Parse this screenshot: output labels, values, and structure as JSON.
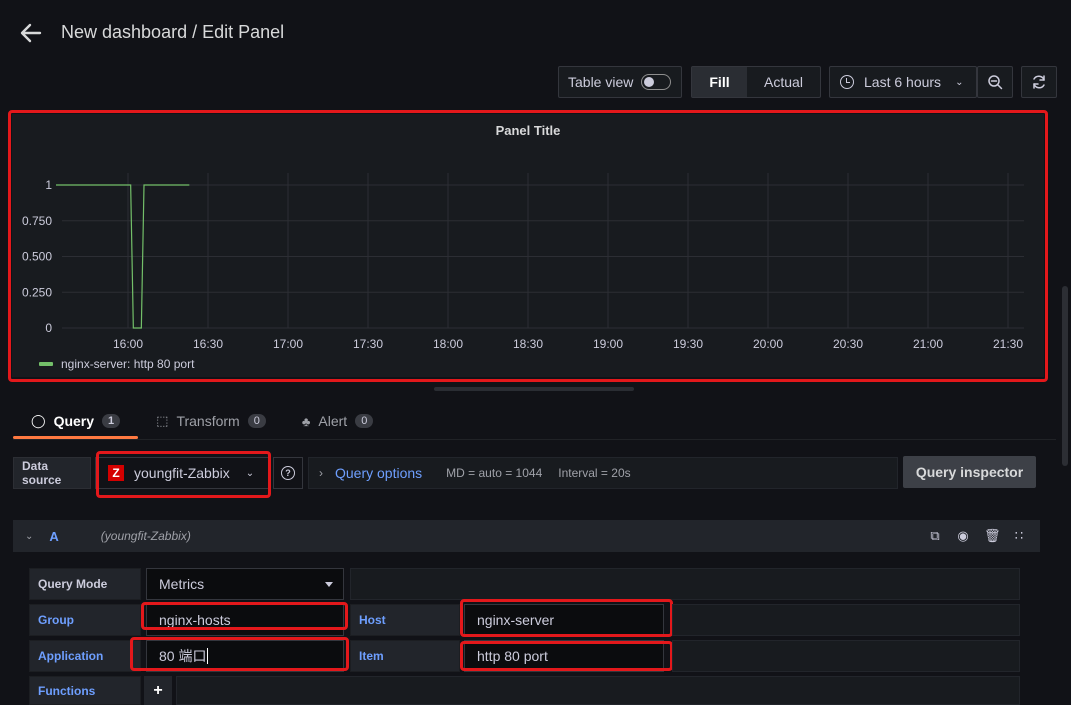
{
  "header": {
    "title": "New dashboard / Edit Panel"
  },
  "toolbar": {
    "table_view_label": "Table view",
    "fill_label": "Fill",
    "actual_label": "Actual",
    "time_range_label": "Last 6 hours"
  },
  "panel": {
    "title": "Panel Title",
    "legend": "nginx-server: http 80 port"
  },
  "chart_data": {
    "type": "line",
    "x_ticks": [
      "16:00",
      "16:30",
      "17:00",
      "17:30",
      "18:00",
      "18:30",
      "19:00",
      "19:30",
      "20:00",
      "20:30",
      "21:00",
      "21:30"
    ],
    "y_ticks": [
      "0",
      "0.250",
      "0.500",
      "0.750",
      "1"
    ],
    "ylim": [
      0,
      1
    ],
    "grid": true,
    "legend_position": "bottom-left",
    "series": [
      {
        "name": "nginx-server: http 80 port",
        "color": "#73bf69",
        "points": [
          {
            "x": "15:33",
            "y": 1
          },
          {
            "x": "16:01",
            "y": 1
          },
          {
            "x": "16:02",
            "y": 0
          },
          {
            "x": "16:05",
            "y": 0
          },
          {
            "x": "16:06",
            "y": 1
          },
          {
            "x": "16:23",
            "y": 1
          }
        ]
      }
    ]
  },
  "tabs": [
    {
      "label": "Query",
      "count": "1"
    },
    {
      "label": "Transform",
      "count": "0"
    },
    {
      "label": "Alert",
      "count": "0"
    }
  ],
  "datasource": {
    "label": "Data source",
    "name": "youngfit-Zabbix",
    "logo_letter": "Z",
    "help_glyph": "?"
  },
  "query_options": {
    "label": "Query options",
    "md": "MD = auto = 1044",
    "interval": "Interval = 20s"
  },
  "query_inspector_label": "Query inspector",
  "query_row": {
    "name": "A",
    "datasource": "(youngfit-Zabbix)"
  },
  "fields": {
    "query_mode_label": "Query Mode",
    "query_mode_value": "Metrics",
    "group_label": "Group",
    "group_value": "nginx-hosts",
    "host_label": "Host",
    "host_value": "nginx-server",
    "application_label": "Application",
    "application_value": "80 端口",
    "item_label": "Item",
    "item_value": "http 80 port",
    "functions_label": "Functions"
  },
  "colors": {
    "highlight": "#e3181b",
    "series": "#73bf69",
    "accent": "#ff7941",
    "link": "#6e9fff"
  }
}
